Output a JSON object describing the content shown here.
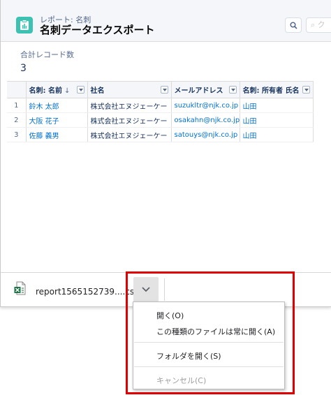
{
  "header": {
    "subtitle": "レポート: 名刺",
    "title": "名刺データエクスポート",
    "extra_button_label": "ク"
  },
  "summary": {
    "total_label": "合計レコード数",
    "total_value": "3"
  },
  "table": {
    "columns": [
      {
        "label": "名刺: 名前",
        "sort": "↓"
      },
      {
        "label": "社名"
      },
      {
        "label": "メールアドレス"
      },
      {
        "label": "名刺: 所有者 氏名"
      }
    ],
    "rows": [
      {
        "num": "1",
        "name": "鈴木 太郎",
        "company": "株式会社エヌジェーケー",
        "email": "suzukltr@njk.co.jp",
        "owner": "山田"
      },
      {
        "num": "2",
        "name": "大阪 花子",
        "company": "株式会社エヌジェーケー",
        "email": "osakahn@njk.co.jp",
        "owner": "山田"
      },
      {
        "num": "3",
        "name": "佐藤 義男",
        "company": "株式会社エヌジェーケー",
        "email": "satouys@njk.co.jp",
        "owner": "山田"
      }
    ]
  },
  "download": {
    "file_name": "report1565152739....csv"
  },
  "context_menu": {
    "open": "開く(O)",
    "always_open": "この種類のファイルは常に開く(A)",
    "open_folder": "フォルダを開く(S)",
    "cancel": "キャンセル(C)"
  },
  "colors": {
    "accent": "#3cc2b3",
    "link": "#0070d2",
    "highlight": "#e00000"
  }
}
